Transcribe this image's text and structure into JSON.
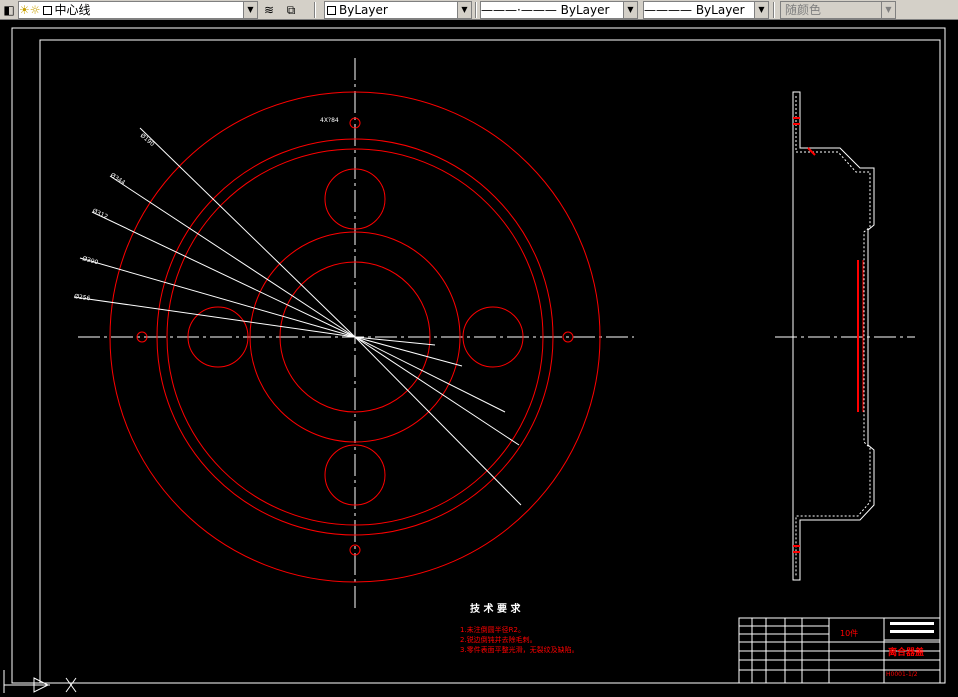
{
  "toolbar": {
    "layer_name": "中心线",
    "color_value": "ByLayer",
    "linetype_value": "ByLayer",
    "lineweight_value": "ByLayer",
    "plotstyle_value": "随颜色"
  },
  "drawing": {
    "labels": {
      "top_hole": "4X?84",
      "d1": "Ø190",
      "d2": "Ø344",
      "d3": "Ø312",
      "d4": "Ø390",
      "d5": "Ø256"
    },
    "notes_title": "技 术 要 求",
    "notes": [
      "1.未注倒圆半径R2。",
      "2.锐边倒钝并去除毛刺。",
      "3.零件表面平整光滑，无裂纹及缺陷。"
    ],
    "title_block": {
      "qty": "10件",
      "part_name": "离合器盖",
      "drawing_no": "H0001-1/2"
    }
  },
  "colors": {
    "background": "#000000",
    "geometry": "#ff0000",
    "centerline": "#ffffff",
    "dimension": "#ffffff"
  }
}
